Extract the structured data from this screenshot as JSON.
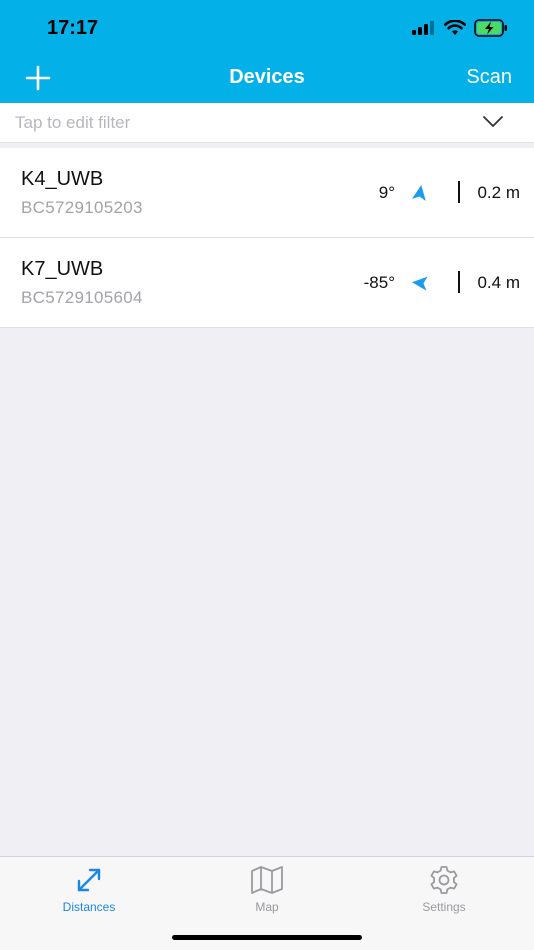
{
  "status_bar": {
    "time": "17:17",
    "icons": [
      "cellular-signal-icon",
      "wifi-icon",
      "battery-charging-icon"
    ]
  },
  "nav": {
    "title": "Devices",
    "left_icon": "plus-icon",
    "right_label": "Scan"
  },
  "filter": {
    "placeholder": "Tap to edit filter",
    "icon": "chevron-down-icon"
  },
  "devices": [
    {
      "name": "K4_UWB",
      "id": "BC5729105203",
      "angle": "9°",
      "distance": "0.2 m",
      "bearing_deg": 9
    },
    {
      "name": "K7_UWB",
      "id": "BC5729105604",
      "angle": "-85°",
      "distance": "0.4 m",
      "bearing_deg": -85
    }
  ],
  "tabbar": {
    "items": [
      {
        "label": "Distances",
        "icon": "distance-arrows-icon",
        "active": true
      },
      {
        "label": "Map",
        "icon": "map-icon",
        "active": false
      },
      {
        "label": "Settings",
        "icon": "gear-icon",
        "active": false
      }
    ]
  },
  "colors": {
    "header": "#03b0e8",
    "accent": "#1a88e3",
    "arrow": "#1c9bf0",
    "battery": "#4cd964"
  }
}
